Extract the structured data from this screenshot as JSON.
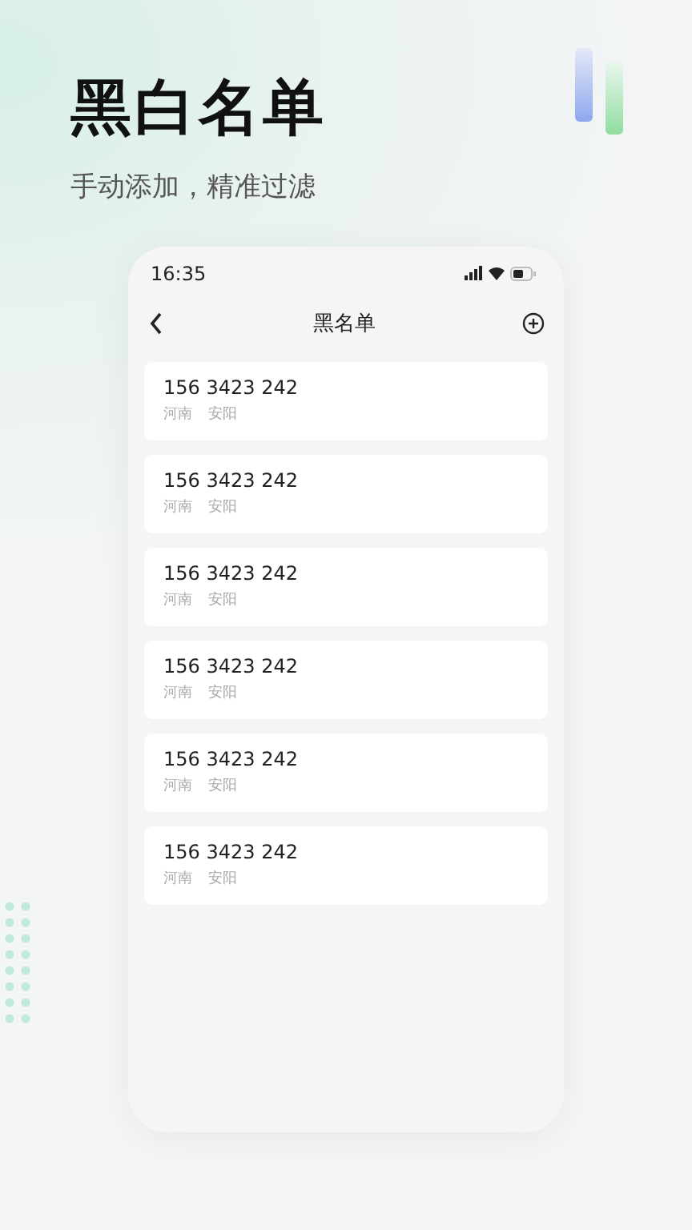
{
  "headline": "黑白名单",
  "subtitle": "手动添加，精准过滤",
  "phone": {
    "status_bar": {
      "time": "16:35"
    },
    "nav_bar": {
      "title": "黑名单"
    },
    "entries": [
      {
        "number": "156 3423 242",
        "province": "河南",
        "city": "安阳"
      },
      {
        "number": "156 3423 242",
        "province": "河南",
        "city": "安阳"
      },
      {
        "number": "156 3423 242",
        "province": "河南",
        "city": "安阳"
      },
      {
        "number": "156 3423 242",
        "province": "河南",
        "city": "安阳"
      },
      {
        "number": "156 3423 242",
        "province": "河南",
        "city": "安阳"
      },
      {
        "number": "156 3423 242",
        "province": "河南",
        "city": "安阳"
      }
    ]
  }
}
